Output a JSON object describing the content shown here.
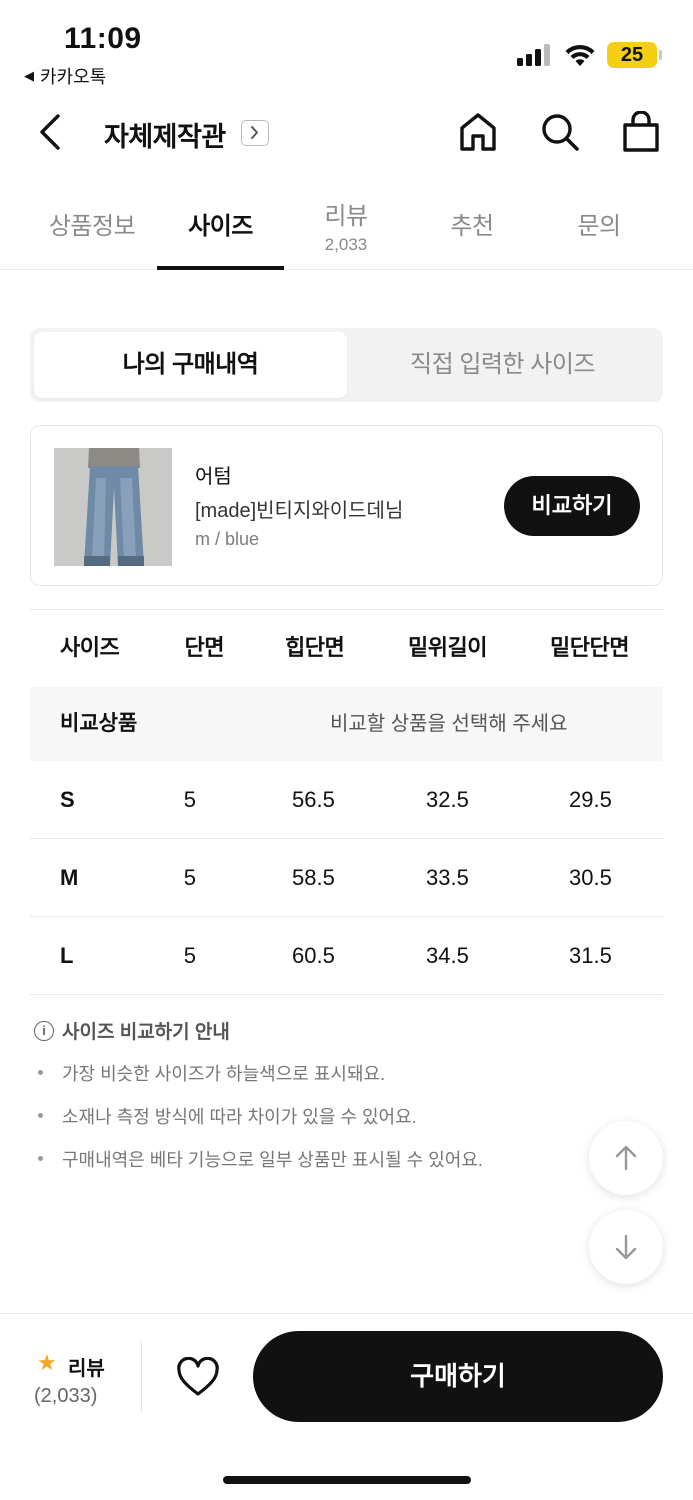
{
  "status_bar": {
    "time": "11:09",
    "back_app": "카카오톡",
    "battery": "25"
  },
  "header": {
    "title": "자체제작관",
    "icons": [
      "back-arrow-icon",
      "chevron-right-icon",
      "home-icon",
      "search-icon",
      "shopping-bag-icon"
    ]
  },
  "tabs": [
    {
      "label": "상품정보",
      "sub": ""
    },
    {
      "label": "사이즈",
      "sub": ""
    },
    {
      "label": "리뷰",
      "sub": "2,033"
    },
    {
      "label": "추천",
      "sub": ""
    },
    {
      "label": "문의",
      "sub": ""
    }
  ],
  "active_tab": "사이즈",
  "segment": {
    "left": "나의 구매내역",
    "right": "직접 입력한 사이즈",
    "selected": "나의 구매내역"
  },
  "product": {
    "brand": "어텀",
    "name": "[made]빈티지와이드데님",
    "option": "m / blue",
    "compare_button": "비교하기"
  },
  "size_table": {
    "headers": [
      "사이즈",
      "단면",
      "힙단면",
      "밑위길이",
      "밑단단면"
    ],
    "compare_label": "비교상품",
    "compare_message": "비교할 상품을 선택해 주세요",
    "rows": [
      {
        "size": "S",
        "clipped": "5",
        "hip": "56.5",
        "rise": "32.5",
        "hem": "29.5"
      },
      {
        "size": "M",
        "clipped": "5",
        "hip": "58.5",
        "rise": "33.5",
        "hem": "30.5"
      },
      {
        "size": "L",
        "clipped": "5",
        "hip": "60.5",
        "rise": "34.5",
        "hem": "31.5"
      }
    ]
  },
  "info": {
    "title": "사이즈 비교하기 안내",
    "items": [
      "가장 비슷한 사이즈가 하늘색으로 표시돼요.",
      "소재나 측정 방식에 따라 차이가 있을 수 있어요.",
      "구매내역은 베타 기능으로 일부 상품만 표시될 수 있어요."
    ]
  },
  "bottom_bar": {
    "review_label": "리뷰",
    "review_count": "(2,033)",
    "buy_button": "구매하기"
  },
  "colors": {
    "accent": "#111111",
    "battery": "#f5cf12",
    "star": "#f5a623",
    "muted_text": "#8a8a8a"
  }
}
